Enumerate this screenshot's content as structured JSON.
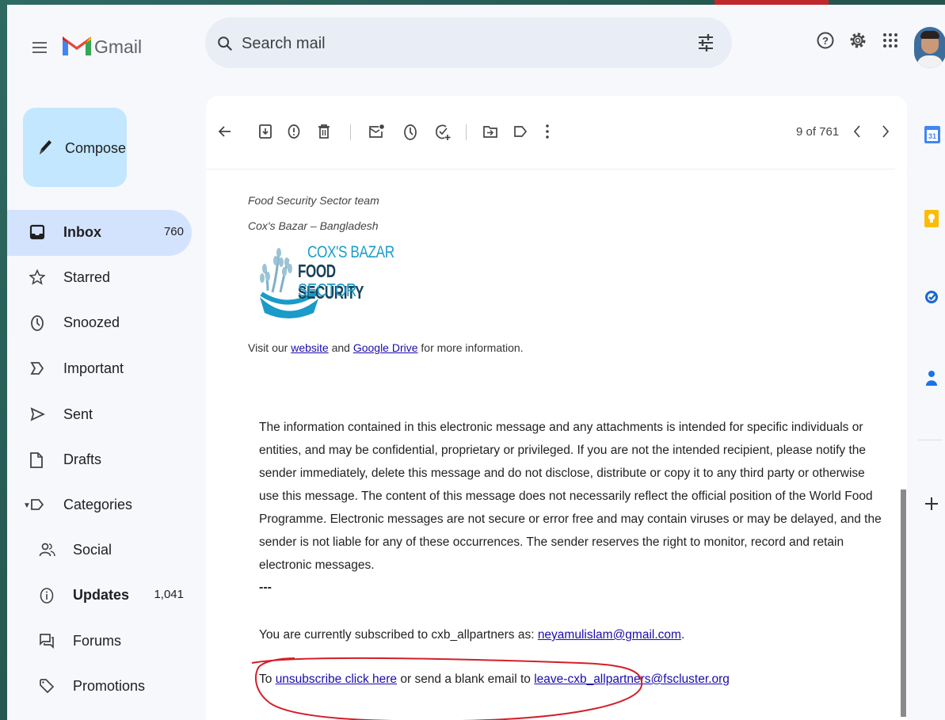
{
  "app": {
    "name": "Gmail"
  },
  "search": {
    "placeholder": "Search mail"
  },
  "compose": {
    "label": "Compose"
  },
  "nav": {
    "inbox": {
      "label": "Inbox",
      "count": "760"
    },
    "starred": {
      "label": "Starred"
    },
    "snoozed": {
      "label": "Snoozed"
    },
    "important": {
      "label": "Important"
    },
    "sent": {
      "label": "Sent"
    },
    "drafts": {
      "label": "Drafts"
    },
    "categories": {
      "label": "Categories"
    },
    "social": {
      "label": "Social"
    },
    "updates": {
      "label": "Updates",
      "count": "1,041"
    },
    "forums": {
      "label": "Forums"
    },
    "promotions": {
      "label": "Promotions"
    }
  },
  "toolbar": {
    "pager": "9 of 761"
  },
  "email": {
    "signature_team": "Food Security Sector team",
    "signature_location": "Cox's Bazar – Bangladesh",
    "logo_line1": "COX'S BAZAR",
    "logo_line2": "FOOD SECURITY",
    "logo_line3": "SECTOR",
    "visit_prefix": "Visit our ",
    "website_link": "website",
    "visit_and": " and ",
    "drive_link": "Google Drive",
    "visit_suffix": " for more information.",
    "disclaimer": "The information contained in this electronic message and any attachments is intended for specific individuals or entities, and may be confidential, proprietary or privileged. If you are not the intended recipient, please notify the sender immediately, delete this message and do not disclose, distribute or copy it to any third party or otherwise use this message. The content of this message does not necessarily reflect the official position of the World Food Programme. Electronic messages are not secure or error free and may contain viruses or may be delayed, and the sender is not liable for any of these occurrences. The sender reserves the right to monitor, record and retain electronic messages.",
    "separator": "---",
    "subscribed_prefix": "You are currently subscribed to cxb_allpartners as: ",
    "subscribed_email": "neyamulislam@gmail.com",
    "subscribed_suffix": ".",
    "unsub_prefix": "To ",
    "unsub_link": "unsubscribe click here",
    "unsub_middle": " or send a blank email to ",
    "leave_email": "leave-cxb_allpartners@fscluster.org"
  },
  "icons": {
    "menu": "hamburger-icon",
    "search": "search-icon",
    "tune": "tune-icon",
    "help": "help-icon",
    "settings": "gear-icon",
    "apps": "apps-grid-icon"
  },
  "colors": {
    "gmail_red": "#ea4335",
    "compose_bg": "#c2e7ff",
    "active_nav": "#d3e3fd",
    "logo_blue": "#1a9bc9",
    "annotation_red": "#d2202a",
    "link": "#1a0dab"
  }
}
